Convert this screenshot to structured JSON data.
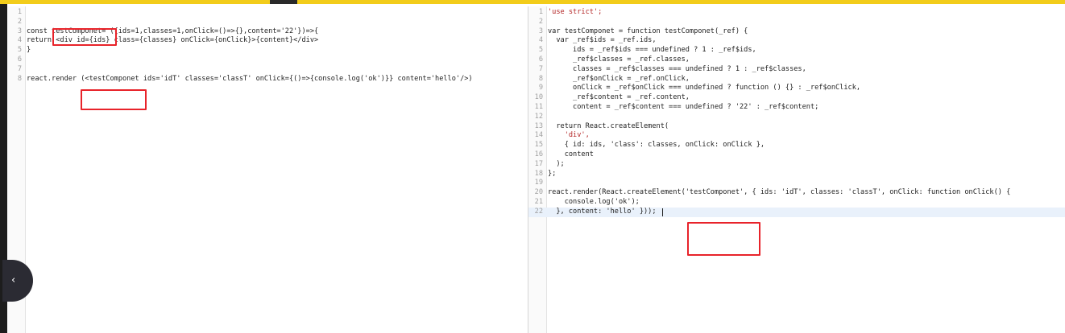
{
  "left_editor": {
    "lines": [
      {
        "n": "1",
        "text": ""
      },
      {
        "n": "2",
        "text": ""
      },
      {
        "n": "3",
        "text": "const testComponet= ({ids=1,classes=1,onClick=()=>{},content='22'})=>{"
      },
      {
        "n": "4",
        "text": "return <div id={ids} class={classes} onClick={onClick}>{content}</div>"
      },
      {
        "n": "5",
        "text": "}"
      },
      {
        "n": "6",
        "text": ""
      },
      {
        "n": "7",
        "text": ""
      },
      {
        "n": "8",
        "text": "react.render (<testComponet ids='idT' classes='classT' onClick={()=>{console.log('ok')}} content='hello'/>)"
      }
    ]
  },
  "right_editor": {
    "lines": [
      {
        "n": "1",
        "text": "'use strict';"
      },
      {
        "n": "2",
        "text": ""
      },
      {
        "n": "3",
        "text": "var testComponet = function testComponet(_ref) {"
      },
      {
        "n": "4",
        "text": "  var _ref$ids = _ref.ids,"
      },
      {
        "n": "5",
        "text": "      ids = _ref$ids === undefined ? 1 : _ref$ids,"
      },
      {
        "n": "6",
        "text": "      _ref$classes = _ref.classes,"
      },
      {
        "n": "7",
        "text": "      classes = _ref$classes === undefined ? 1 : _ref$classes,"
      },
      {
        "n": "8",
        "text": "      _ref$onClick = _ref.onClick,"
      },
      {
        "n": "9",
        "text": "      onClick = _ref$onClick === undefined ? function () {} : _ref$onClick,"
      },
      {
        "n": "10",
        "text": "      _ref$content = _ref.content,"
      },
      {
        "n": "11",
        "text": "      content = _ref$content === undefined ? '22' : _ref$content;"
      },
      {
        "n": "12",
        "text": ""
      },
      {
        "n": "13",
        "text": "  return React.createElement("
      },
      {
        "n": "14",
        "text": "    'div',"
      },
      {
        "n": "15",
        "text": "    { id: ids, 'class': classes, onClick: onClick },"
      },
      {
        "n": "16",
        "text": "    content"
      },
      {
        "n": "17",
        "text": "  );"
      },
      {
        "n": "18",
        "text": "};"
      },
      {
        "n": "19",
        "text": ""
      },
      {
        "n": "20",
        "text": "react.render(React.createElement('testComponet', { ids: 'idT', classes: 'classT', onClick: function onClick() {"
      },
      {
        "n": "21",
        "text": "    console.log('ok');"
      },
      {
        "n": "22",
        "text": "  }, content: 'hello' }));"
      }
    ]
  },
  "colors": {
    "top_bar": "#f2cc1a",
    "highlight_box": "#e8232a",
    "active_line": "#e9f1fb"
  },
  "icons": {
    "collapse": "chevron-left-icon"
  }
}
